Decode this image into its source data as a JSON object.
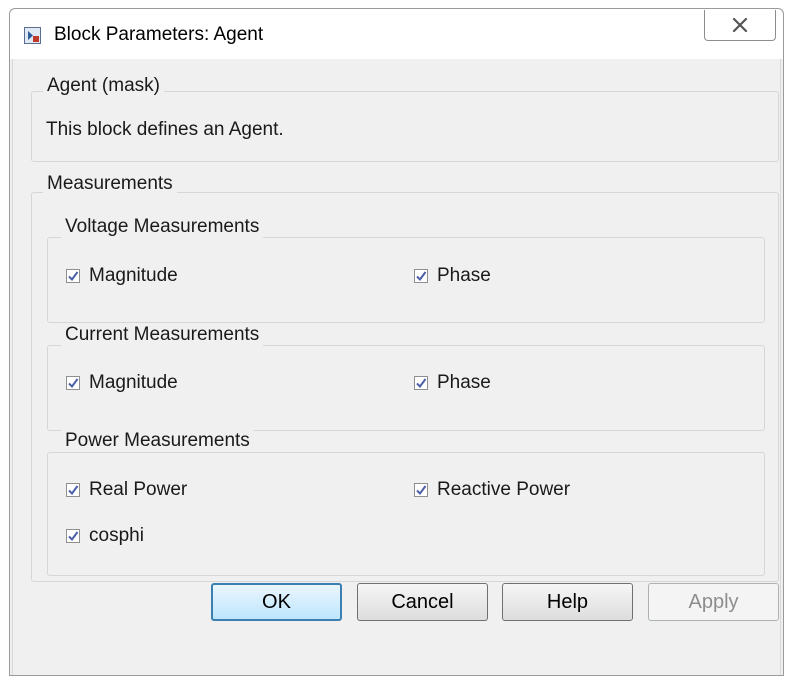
{
  "window": {
    "title": "Block Parameters: Agent",
    "close_icon": "close-icon"
  },
  "mask": {
    "legend": "Agent (mask)",
    "description": "This block defines an Agent."
  },
  "measurements": {
    "legend": "Measurements",
    "voltage": {
      "legend": "Voltage Measurements",
      "magnitude": {
        "label": "Magnitude",
        "checked": true
      },
      "phase": {
        "label": "Phase",
        "checked": true
      }
    },
    "current": {
      "legend": "Current Measurements",
      "magnitude": {
        "label": "Magnitude",
        "checked": true
      },
      "phase": {
        "label": "Phase",
        "checked": true
      }
    },
    "power": {
      "legend": "Power Measurements",
      "real": {
        "label": "Real Power",
        "checked": true
      },
      "reactive": {
        "label": "Reactive Power",
        "checked": true
      },
      "cosphi": {
        "label": "cosphi",
        "checked": true
      }
    }
  },
  "buttons": {
    "ok": "OK",
    "cancel": "Cancel",
    "help": "Help",
    "apply": "Apply"
  },
  "colors": {
    "default_button_border": "#3c7fb1",
    "check_mark": "#4a5fa8"
  }
}
